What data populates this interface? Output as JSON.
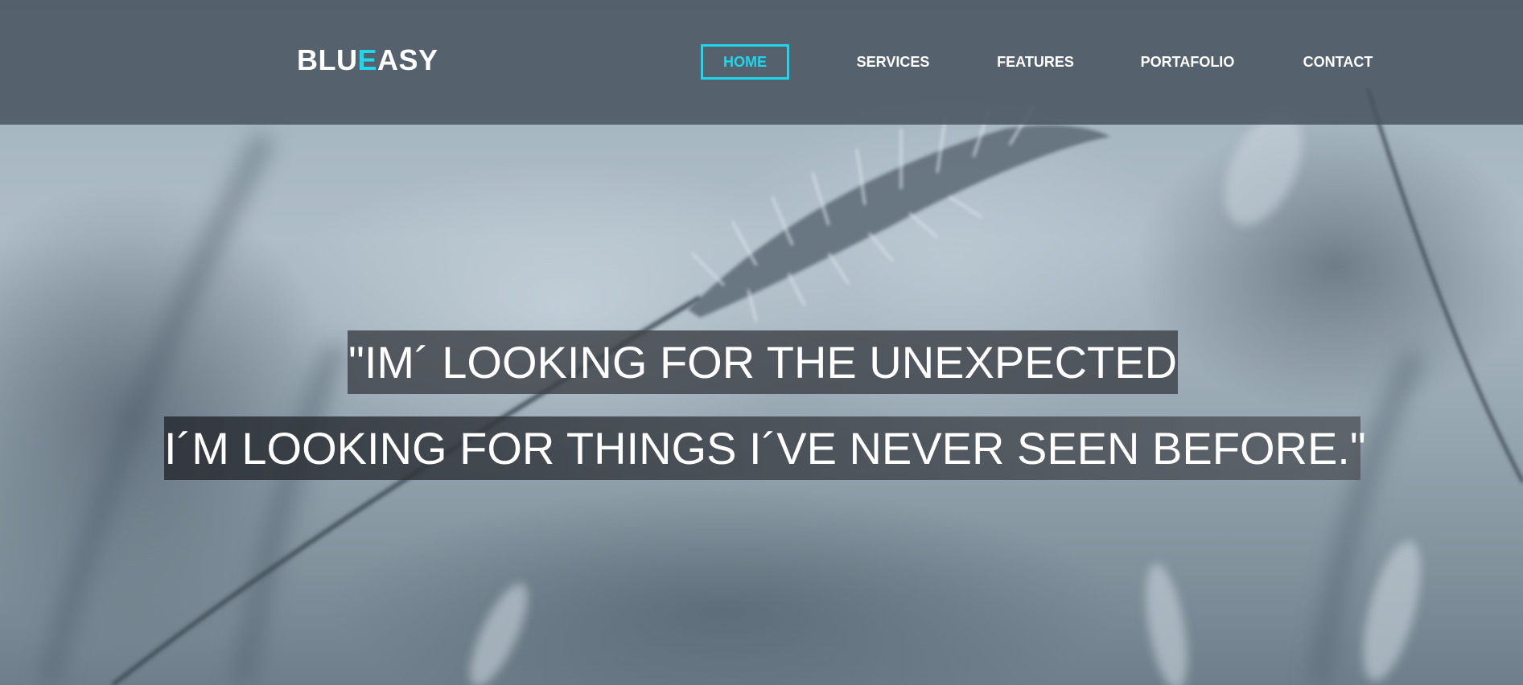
{
  "brand": {
    "logo_part1": "BLU",
    "logo_accent": "E",
    "logo_part2": "ASY",
    "accent_color": "#1fd6ec"
  },
  "nav": {
    "items": [
      {
        "label": "HOME",
        "active": true
      },
      {
        "label": "SERVICES",
        "active": false
      },
      {
        "label": "FEATURES",
        "active": false
      },
      {
        "label": "PORTAFOLIO",
        "active": false
      },
      {
        "label": "CONTACT",
        "active": false
      }
    ]
  },
  "hero": {
    "quote_line1": "\"IM´ LOOKING FOR THE UNEXPECTED",
    "quote_line2": "I´M LOOKING FOR THINGS I´VE NEVER SEEN BEFORE.\""
  },
  "colors": {
    "header_bg": "#48545f",
    "quote_bg": "#3e4248",
    "text": "#ffffff"
  }
}
